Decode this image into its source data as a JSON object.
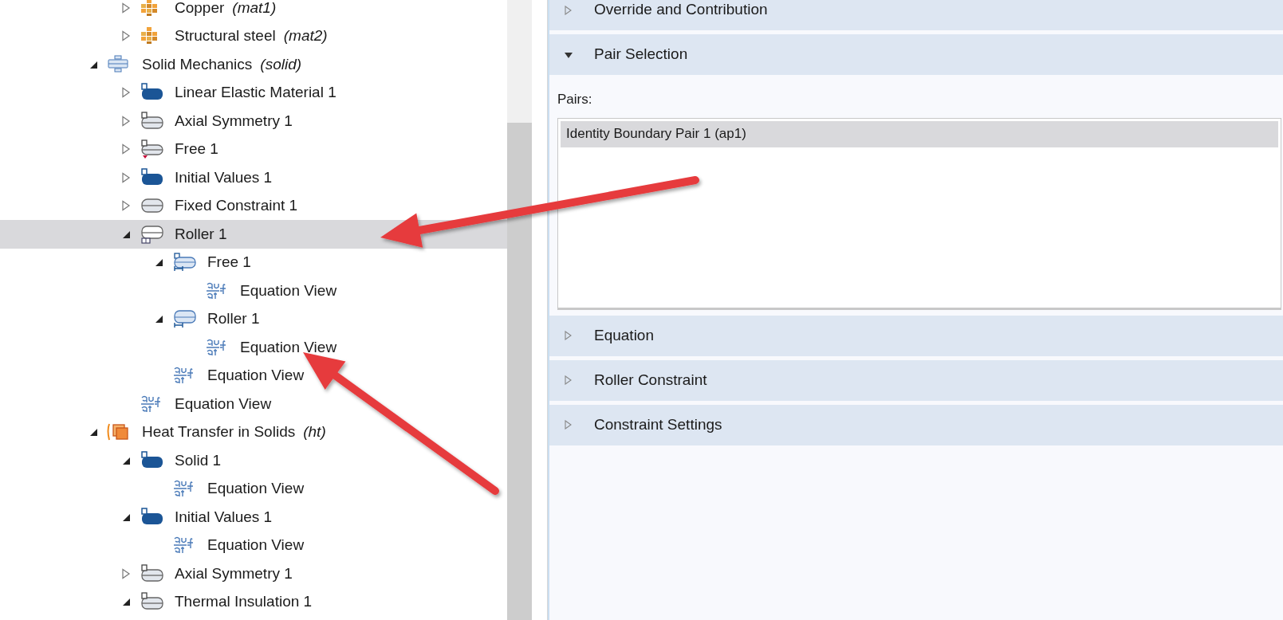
{
  "tree": {
    "material_items": [
      {
        "label": "Copper",
        "tag": "(mat1)",
        "kind": "material",
        "expanded": false,
        "selected": false
      },
      {
        "label": "Structural steel",
        "tag": "(mat2)",
        "kind": "material",
        "expanded": false,
        "selected": false
      }
    ],
    "items": [
      {
        "label": "Solid Mechanics",
        "tag": "(solid)",
        "kind": "solid-physics",
        "expanded": true,
        "selected": false,
        "children": [
          {
            "label": "Linear Elastic Material 1",
            "kind": "domain",
            "expanded": false,
            "selected": false
          },
          {
            "label": "Axial Symmetry 1",
            "kind": "boundary",
            "expanded": false,
            "selected": false
          },
          {
            "label": "Free 1",
            "kind": "boundary-marked",
            "expanded": false,
            "selected": false
          },
          {
            "label": "Initial Values 1",
            "kind": "domain",
            "expanded": false,
            "selected": false
          },
          {
            "label": "Fixed Constraint 1",
            "kind": "boundary-plain",
            "expanded": false,
            "selected": false
          },
          {
            "label": "Roller 1",
            "kind": "roller",
            "expanded": true,
            "selected": true,
            "children": [
              {
                "label": "Free 1",
                "kind": "pair-boundary",
                "expanded": true,
                "selected": false,
                "children": [
                  {
                    "label": "Equation View",
                    "kind": "equation",
                    "selected": false
                  }
                ]
              },
              {
                "label": "Roller 1",
                "kind": "pair-plain",
                "expanded": true,
                "selected": false,
                "children": [
                  {
                    "label": "Equation View",
                    "kind": "equation",
                    "selected": false
                  }
                ]
              },
              {
                "label": "Equation View",
                "kind": "equation",
                "selected": false
              }
            ]
          },
          {
            "label": "Equation View",
            "kind": "equation",
            "selected": false
          }
        ]
      },
      {
        "label": "Heat Transfer in Solids",
        "tag": "(ht)",
        "kind": "heat-physics",
        "expanded": true,
        "selected": false,
        "children": [
          {
            "label": "Solid 1",
            "kind": "domain",
            "expanded": true,
            "selected": false,
            "children": [
              {
                "label": "Equation View",
                "kind": "equation",
                "selected": false
              }
            ]
          },
          {
            "label": "Initial Values 1",
            "kind": "domain",
            "expanded": true,
            "selected": false,
            "children": [
              {
                "label": "Equation View",
                "kind": "equation",
                "selected": false
              }
            ]
          },
          {
            "label": "Axial Symmetry 1",
            "kind": "boundary",
            "expanded": false,
            "selected": false
          },
          {
            "label": "Thermal Insulation 1",
            "kind": "boundary",
            "expanded": true,
            "selected": false
          }
        ]
      }
    ]
  },
  "settings": {
    "sections": [
      {
        "title": "Override and Contribution",
        "expanded": false
      },
      {
        "title": "Pair Selection",
        "expanded": true,
        "field_label": "Pairs:",
        "pairs": [
          {
            "label": "Identity Boundary Pair 1 (ap1)",
            "selected": true
          }
        ]
      },
      {
        "title": "Equation",
        "expanded": false
      },
      {
        "title": "Roller Constraint",
        "expanded": false
      },
      {
        "title": "Constraint Settings",
        "expanded": false
      }
    ]
  },
  "annotations": [
    {
      "kind": "arrow"
    },
    {
      "kind": "arrow"
    }
  ]
}
